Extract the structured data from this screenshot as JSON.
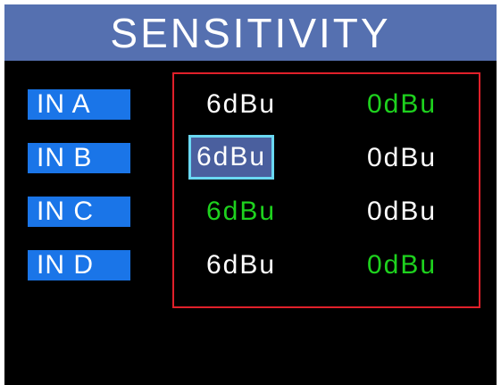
{
  "header": {
    "title": "SENSITIVITY"
  },
  "inputs": [
    {
      "label": "IN A",
      "col1": "6dBu",
      "col2": "0dBu"
    },
    {
      "label": "IN B",
      "col1": "6dBu",
      "col2": "0dBu"
    },
    {
      "label": "IN C",
      "col1": "6dBu",
      "col2": "0dBu"
    },
    {
      "label": "IN D",
      "col1": "6dBu",
      "col2": "0dBu"
    }
  ],
  "colors": {
    "title_bar": "#5570b0",
    "label_bg": "#1a75e8",
    "active_value": "#1ed21e",
    "inactive_value": "#ffffff",
    "matrix_border": "#e0202a",
    "selection_border": "#6ad8f2",
    "selection_fill": "#4a5f9e"
  }
}
